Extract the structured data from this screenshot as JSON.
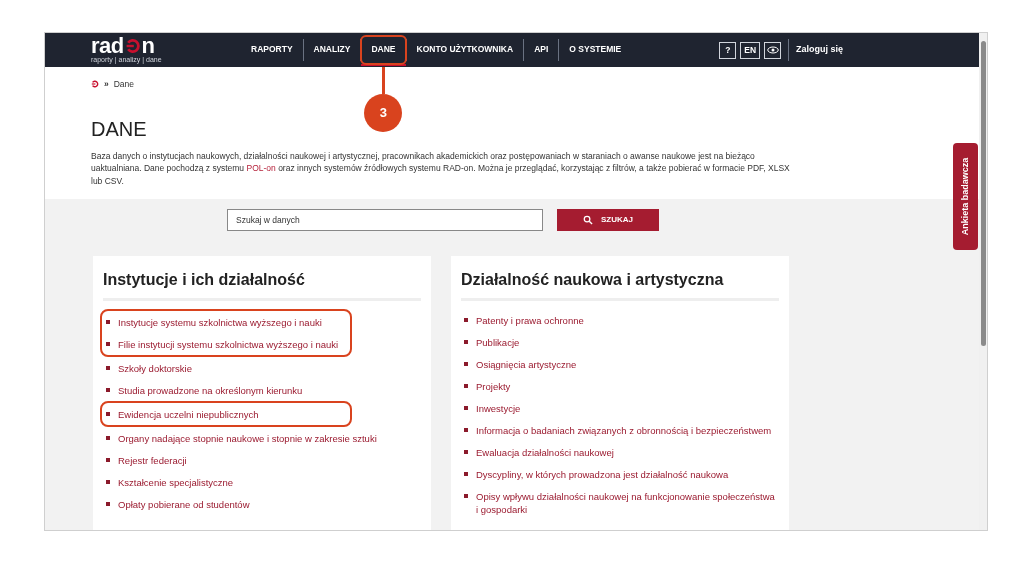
{
  "logo": {
    "text_before": "rad",
    "text_after": "n",
    "tagline": "raporty | analizy | dane"
  },
  "nav": [
    {
      "label": "RAPORTY",
      "selected": false
    },
    {
      "label": "ANALIZY",
      "selected": false
    },
    {
      "label": "DANE",
      "selected": true,
      "annotated": true,
      "callout": "3"
    },
    {
      "label": "KONTO UŻYTKOWNIKA",
      "selected": false
    },
    {
      "label": "API",
      "selected": false
    },
    {
      "label": "O SYSTEMIE",
      "selected": false
    }
  ],
  "header_buttons": [
    "?",
    "EN"
  ],
  "login": "Zaloguj się",
  "breadcrumb": {
    "separator": "»",
    "current": "Dane"
  },
  "title": "DANE",
  "intro": {
    "before": "Baza danych o instytucjach naukowych, działalności naukowej i artystycznej, pracownikach akademickich oraz postępowaniach w staraniach o awanse naukowe jest na bieżąco uaktualniana. Dane pochodzą z systemu ",
    "link": "POL-on",
    "after": " oraz innych systemów źródłowych systemu RAD-on. Można je przeglądać, korzystając z filtrów, a także pobierać w formacie PDF, XLSX lub CSV."
  },
  "search": {
    "placeholder": "Szukaj w danych",
    "button": "SZUKAJ"
  },
  "side_tab": "Ankieta badawcza",
  "cards": [
    {
      "title": "Instytucje i ich działalność",
      "items": [
        {
          "label": "Instytucje systemu szkolnictwa wyższego i nauki",
          "annotated": true
        },
        {
          "label": "Filie instytucji systemu szkolnictwa wyższego i nauki",
          "annotated": true
        },
        {
          "label": "Szkoły doktorskie",
          "annotated": false
        },
        {
          "label": "Studia prowadzone na określonym kierunku",
          "annotated": false
        },
        {
          "label": "Ewidencja uczelni niepublicznych",
          "annotated": true
        },
        {
          "label": "Organy nadające stopnie naukowe i stopnie w zakresie sztuki",
          "annotated": false
        },
        {
          "label": "Rejestr federacji",
          "annotated": false
        },
        {
          "label": "Kształcenie specjalistyczne",
          "annotated": false
        },
        {
          "label": "Opłaty pobierane od studentów",
          "annotated": false
        }
      ]
    },
    {
      "title": "Działalność naukowa i artystyczna",
      "items": [
        {
          "label": "Patenty i prawa ochronne",
          "annotated": false
        },
        {
          "label": "Publikacje",
          "annotated": false
        },
        {
          "label": "Osiągnięcia artystyczne",
          "annotated": false
        },
        {
          "label": "Projekty",
          "annotated": false
        },
        {
          "label": "Inwestycje",
          "annotated": false
        },
        {
          "label": "Informacja o badaniach związanych z obronnością i bezpieczeństwem",
          "annotated": false
        },
        {
          "label": "Ewaluacja działalności naukowej",
          "annotated": false
        },
        {
          "label": "Dyscypliny, w których prowadzona jest działalność naukowa",
          "annotated": false
        },
        {
          "label": "Opisy wpływu działalności naukowej na funkcjonowanie społeczeństwa i gospodarki",
          "annotated": false
        }
      ]
    }
  ]
}
